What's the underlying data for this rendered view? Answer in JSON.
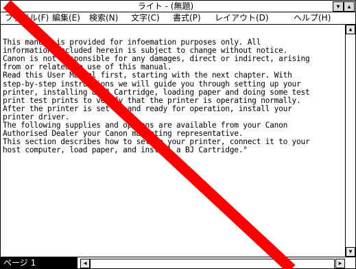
{
  "window": {
    "title": "ライト - (無題)",
    "minimize_glyph": "▼",
    "maximize_glyph": "▲"
  },
  "menu": [
    {
      "label": "ファイル(F)",
      "pos": 6
    },
    {
      "label": "編集(E)",
      "pos": 75
    },
    {
      "label": "検索(N)",
      "pos": 129
    },
    {
      "label": "文字(C)",
      "pos": 190
    },
    {
      "label": "書式(P)",
      "pos": 251
    },
    {
      "label": "レイアウト(D)",
      "pos": 312
    },
    {
      "label": "ヘルプ(H)",
      "pos": 427
    }
  ],
  "document": {
    "lines": [
      "This manual is provided for infoemation purposes only. All",
      "information included herein is subject to change without notice.",
      "Canon is not responsible for any damages, direct or indirect, arising",
      "from or related to use of this manual.",
      "Read this User Manual first, starting with the next chapter. With",
      "step-by-step instructions we will guide you through setting up your",
      "printer, installing a BJ Cartridge, loading paper and doing some test",
      "print test prints to verify that the printer is operating normally.",
      "After the printer is set up and ready for operation, install your",
      "printer driver.",
      "The following supplies and options are available from your Canon",
      "Authorised Dealer your Canon marketing representative.",
      "This section describes how to set up your printer, connect it to your",
      "host computer, load paper, and install a BJ Cartridge.°"
    ]
  },
  "status": {
    "page": "ページ 1"
  },
  "icons": {
    "up": "▲",
    "down": "▼",
    "left": "◀",
    "right": "▶"
  },
  "colors": {
    "annotation_slash": "#ff0000",
    "status_bg": "#000000"
  }
}
